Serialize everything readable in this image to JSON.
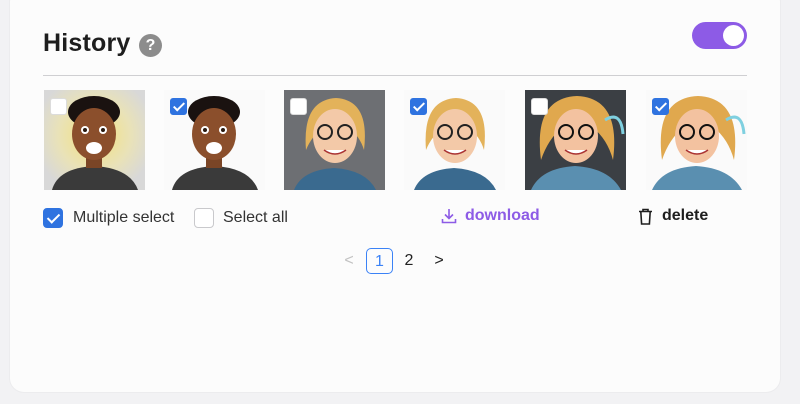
{
  "panel": {
    "title": "History",
    "help_icon": "question-circle-icon",
    "help_glyph": "?",
    "toggle_on": true
  },
  "gallery": [
    {
      "subject": "man-portrait",
      "checked": false
    },
    {
      "subject": "man-portrait",
      "checked": true
    },
    {
      "subject": "woman-portrait",
      "checked": false
    },
    {
      "subject": "woman-portrait",
      "checked": true
    },
    {
      "subject": "woman-portrait",
      "checked": false
    },
    {
      "subject": "woman-portrait",
      "checked": true
    }
  ],
  "controls": {
    "multiple_select_label": "Multiple select",
    "multiple_select_checked": true,
    "select_all_label": "Select all",
    "select_all_checked": false,
    "download_label": "download",
    "download_icon": "download-icon",
    "delete_label": "delete",
    "delete_icon": "trash-icon"
  },
  "pagination": {
    "prev": "<",
    "pages": [
      "1",
      "2"
    ],
    "current": "1",
    "next": ">"
  },
  "colors": {
    "accent": "#8d5be6",
    "checkbox": "#2f73e0",
    "page_active": "#3b82f6"
  }
}
